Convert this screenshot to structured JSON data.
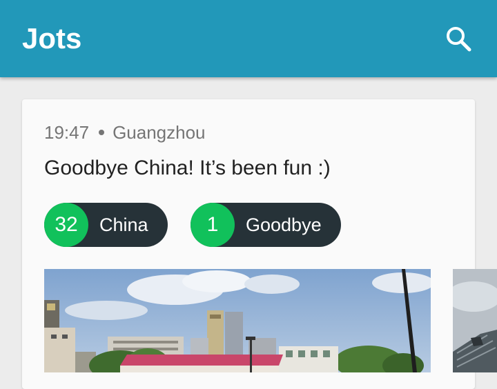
{
  "app_bar": {
    "title": "Jots",
    "search_icon": "search-icon",
    "color": "#2298b9"
  },
  "note": {
    "time": "19:47",
    "location": "Guangzhou",
    "text": "Goodbye China! It’s been fun :)",
    "tags": [
      {
        "count": "32",
        "label": "China"
      },
      {
        "count": "1",
        "label": "Goodbye"
      }
    ],
    "tag_count_color": "#11c15b",
    "tag_bg_color": "#263238",
    "photos": [
      "photo-city-street",
      "photo-modern-building"
    ]
  }
}
